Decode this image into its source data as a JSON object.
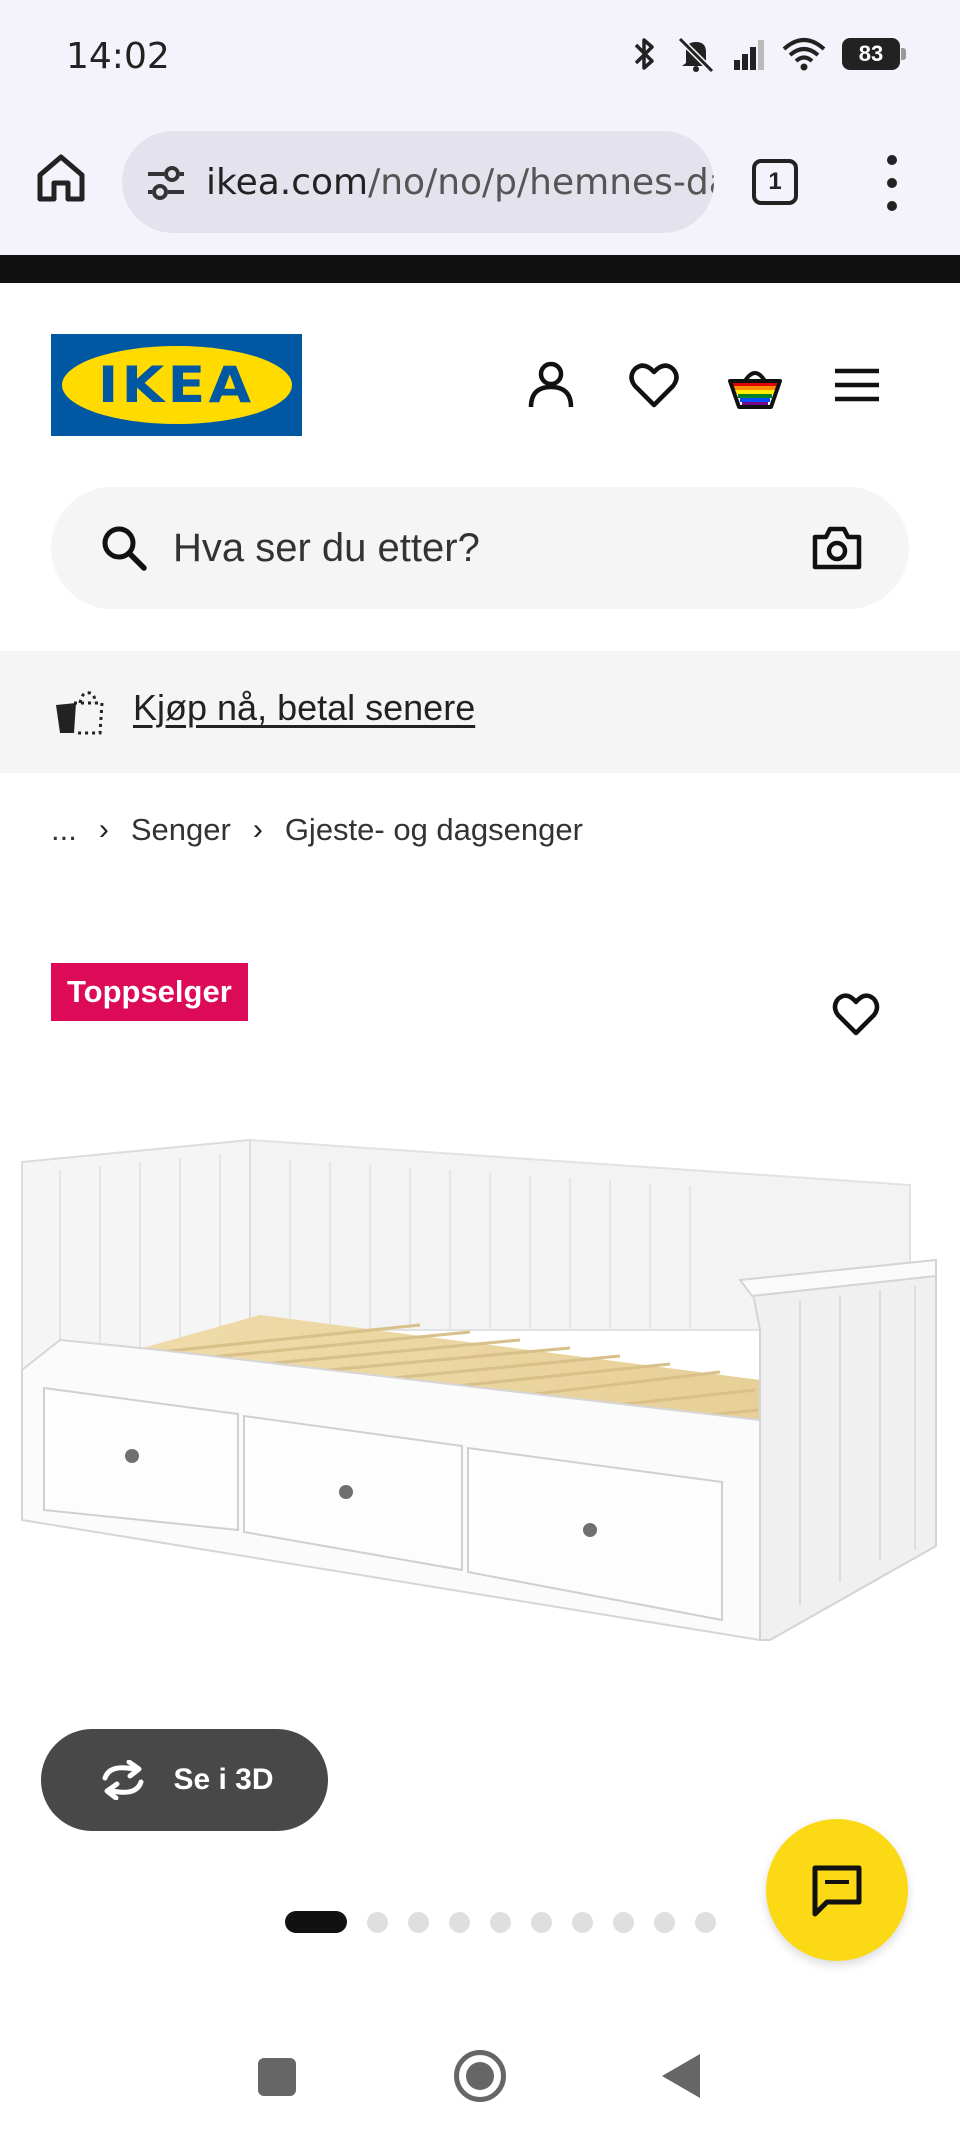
{
  "status_bar": {
    "time": "14:02",
    "battery": "83",
    "icons": [
      "bluetooth-icon",
      "silent-icon",
      "signal-icon",
      "wifi-icon",
      "battery-icon"
    ]
  },
  "browser": {
    "url_main": "ikea.com",
    "url_rest": "/no/no/p/hemnes-da",
    "tab_count": "1"
  },
  "header": {
    "logo_text": "IKEA",
    "brand_blue": "#0058a3",
    "brand_yellow": "#ffdb00",
    "icons": [
      "user-icon",
      "heart-icon",
      "basket-icon",
      "hamburger-menu-icon"
    ]
  },
  "search": {
    "placeholder": "Hva ser du etter?"
  },
  "banner": {
    "link_text": "Kjøp nå, betal senere"
  },
  "breadcrumb": {
    "items": [
      "...",
      "Senger",
      "Gjeste- og dagsenger"
    ]
  },
  "product": {
    "badge": "Toppselger",
    "badge_color": "#dc0a57",
    "view_3d_label": "Se i 3D",
    "gallery_count": 10,
    "gallery_active_index": 0
  },
  "chat": {
    "color": "#fbd914"
  }
}
